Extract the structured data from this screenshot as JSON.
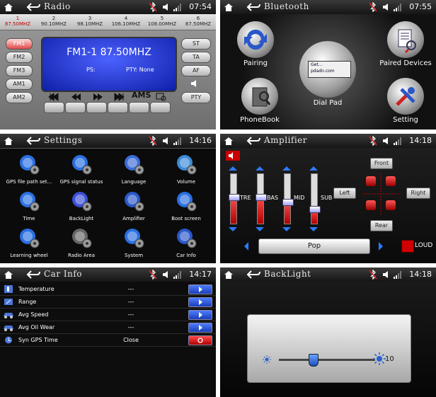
{
  "radio": {
    "title": "Radio",
    "time": "07:54",
    "presets": [
      {
        "num": "1",
        "freq": "87.50MHZ",
        "active": true
      },
      {
        "num": "2",
        "freq": "90.10MHZ",
        "active": false
      },
      {
        "num": "3",
        "freq": "98.10MHZ",
        "active": false
      },
      {
        "num": "4",
        "freq": "106.10MHZ",
        "active": false
      },
      {
        "num": "5",
        "freq": "108.00MHZ",
        "active": false
      },
      {
        "num": "6",
        "freq": "87.50MHZ",
        "active": false
      }
    ],
    "bands": [
      "FM1",
      "FM2",
      "FM3",
      "AM1",
      "AM2"
    ],
    "right_buttons": [
      "ST",
      "TA",
      "AF"
    ],
    "pty_label": "PTY",
    "display_main": "FM1-1 87.50MHZ",
    "ps_label": "PS:",
    "pty_value": "PTY:  None",
    "ams_label": "AMS"
  },
  "bluetooth": {
    "title": "Bluetooth",
    "time": "07:55",
    "items": [
      "Pairing",
      "Paired Devices",
      "Dial Pad",
      "PhoneBook",
      "Setting"
    ],
    "dialpad_screen": [
      "Get...",
      "pdadn.com"
    ]
  },
  "settings": {
    "title": "Settings",
    "time": "14:16",
    "items": [
      "GPS file path set...",
      "GPS signal status",
      "Language",
      "Volume",
      "Time",
      "BackLight",
      "Amplifier",
      "Boot screen",
      "Learning wheel",
      "Radio Area",
      "System",
      "Car Info"
    ]
  },
  "amplifier": {
    "title": "Amplifier",
    "time": "14:18",
    "sliders": [
      {
        "label": "TRE",
        "level": 0.55
      },
      {
        "label": "BAS",
        "level": 0.55
      },
      {
        "label": "MID",
        "level": 0.45
      },
      {
        "label": "SUB",
        "level": 0.3
      }
    ],
    "positions": [
      "Front",
      "Left",
      "Right",
      "Rear"
    ],
    "preset": "Pop",
    "loud_label": "LOUD"
  },
  "carinfo": {
    "title": "Car Info",
    "time": "14:17",
    "rows": [
      {
        "label": "Temperature",
        "value": "---"
      },
      {
        "label": "Range",
        "value": "---"
      },
      {
        "label": "Avg Speed",
        "value": "---"
      },
      {
        "label": "Avg Oil Wear",
        "value": "---"
      },
      {
        "label": "Syn GPS Time",
        "value": "Close"
      }
    ]
  },
  "backlight": {
    "title": "BackLight",
    "time": "14:18",
    "value": "10",
    "level": 0.35
  },
  "colors": {
    "accent_blue": "#2b7bff",
    "active_red": "#c00000",
    "lcd_blue": "#2233cc"
  }
}
